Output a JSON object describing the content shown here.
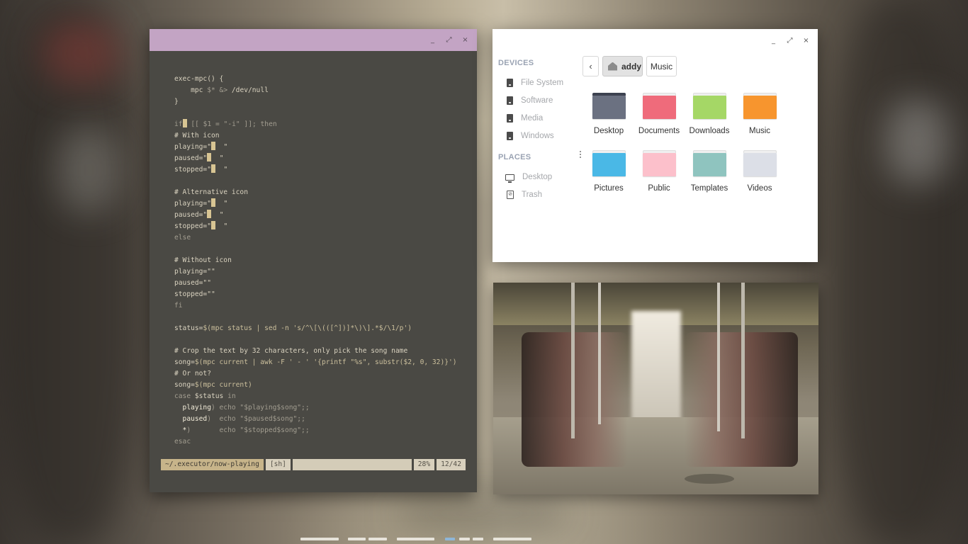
{
  "terminal": {
    "window_controls": [
      "_",
      "⤢",
      "×"
    ],
    "lines": [
      [
        [
          "exec-mpc() {",
          ""
        ]
      ],
      [
        [
          "    mpc ",
          ""
        ],
        [
          "$*",
          "dim"
        ],
        [
          " &> ",
          "dim"
        ],
        [
          "/dev/null",
          ""
        ]
      ],
      [
        [
          "}",
          ""
        ]
      ],
      [
        [
          "",
          ""
        ]
      ],
      [
        [
          "if",
          "dim"
        ],
        [
          "CURSOR",
          ""
        ],
        [
          " [[ $1 = \"-i\" ]]; then",
          "dim"
        ]
      ],
      [
        [
          "# With icon",
          ""
        ]
      ],
      [
        [
          "playing=\"",
          ""
        ],
        [
          "CURSOR",
          ""
        ],
        [
          "  \"",
          ""
        ]
      ],
      [
        [
          "paused=\"",
          ""
        ],
        [
          "CURSOR",
          ""
        ],
        [
          "  \"",
          ""
        ]
      ],
      [
        [
          "stopped=\"",
          ""
        ],
        [
          "CURSOR",
          ""
        ],
        [
          "  \"",
          ""
        ]
      ],
      [
        [
          "",
          ""
        ]
      ],
      [
        [
          "# Alternative icon",
          ""
        ]
      ],
      [
        [
          "playing=\"",
          ""
        ],
        [
          "CURSOR",
          ""
        ],
        [
          "  \"",
          ""
        ]
      ],
      [
        [
          "paused=\"",
          ""
        ],
        [
          "CURSOR",
          ""
        ],
        [
          "  \"",
          ""
        ]
      ],
      [
        [
          "stopped=\"",
          ""
        ],
        [
          "CURSOR",
          ""
        ],
        [
          "  \"",
          ""
        ]
      ],
      [
        [
          "else",
          "dim"
        ]
      ],
      [
        [
          "",
          ""
        ]
      ],
      [
        [
          "# Without icon",
          ""
        ]
      ],
      [
        [
          "playing=\"\"",
          ""
        ]
      ],
      [
        [
          "paused=\"\"",
          ""
        ]
      ],
      [
        [
          "stopped=\"\"",
          ""
        ]
      ],
      [
        [
          "fi",
          "dim"
        ]
      ],
      [
        [
          "",
          ""
        ]
      ],
      [
        [
          "status=",
          ""
        ],
        [
          "$(mpc status | sed -n 's/^\\[\\(([^])]*\\)\\].*$/\\1/p')",
          "str"
        ]
      ],
      [
        [
          "",
          ""
        ]
      ],
      [
        [
          "# Crop the text by 32 characters, only pick the song name",
          ""
        ]
      ],
      [
        [
          "song=",
          ""
        ],
        [
          "$(mpc current | awk -F ' - ' '{printf \"%s\", substr($2, 0, 32)}')",
          "str"
        ]
      ],
      [
        [
          "# Or not?",
          ""
        ]
      ],
      [
        [
          "song=",
          ""
        ],
        [
          "$(mpc current)",
          "str"
        ]
      ],
      [
        [
          "case",
          "dim"
        ],
        [
          " $status ",
          ""
        ],
        [
          "in",
          "dim"
        ]
      ],
      [
        [
          "  playing",
          "hl"
        ],
        [
          ") echo \"$playing$song\";;",
          "dim"
        ]
      ],
      [
        [
          "  paused",
          "hl"
        ],
        [
          ")  echo \"$paused$song\";;",
          "dim"
        ]
      ],
      [
        [
          "  *",
          "hl"
        ],
        [
          ")       echo \"$stopped$song\";;",
          "dim"
        ]
      ],
      [
        [
          "esac",
          "dim"
        ]
      ]
    ],
    "statusline": {
      "path": "~/.executor/now-playing",
      "filetype": "[sh]",
      "percent": "28%",
      "position": "12/42"
    }
  },
  "files": {
    "window_controls": [
      "_",
      "⤢",
      "×"
    ],
    "devices_header": "DEVICES",
    "devices": [
      "File System",
      "Software",
      "Media",
      "Windows"
    ],
    "places_header": "PLACES",
    "places": [
      "Desktop",
      "Trash"
    ],
    "back": "‹",
    "breadcrumb": [
      "addy",
      "Music"
    ],
    "folders": [
      {
        "name": "Desktop",
        "color": "#6b7181",
        "dark": true
      },
      {
        "name": "Documents",
        "color": "#ef6b7b"
      },
      {
        "name": "Downloads",
        "color": "#a5d766"
      },
      {
        "name": "Music",
        "color": "#f7952e"
      },
      {
        "name": "Pictures",
        "color": "#4ab8e6"
      },
      {
        "name": "Public",
        "color": "#fcc0cb"
      },
      {
        "name": "Templates",
        "color": "#8fc4bf"
      },
      {
        "name": "Videos",
        "color": "#dcdfe7"
      }
    ]
  },
  "workspaces": {
    "active_index": 4,
    "active_color": "#8fb6d8"
  }
}
